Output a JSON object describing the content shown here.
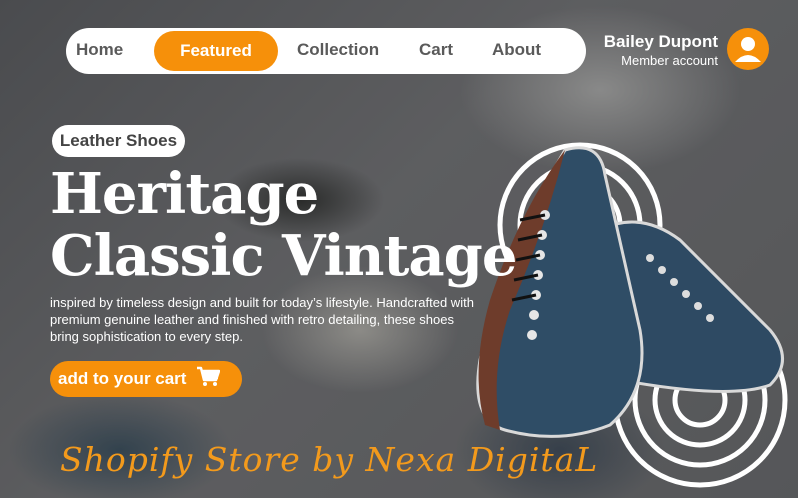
{
  "nav": {
    "items": [
      {
        "label": "Home"
      },
      {
        "label": "Featured"
      },
      {
        "label": "Collection"
      },
      {
        "label": "Cart"
      },
      {
        "label": "About"
      }
    ],
    "active_index": 1
  },
  "user": {
    "name": "Bailey Dupont",
    "role": "Member account",
    "avatar_icon": "user-avatar-icon"
  },
  "hero": {
    "tag": "Leather Shoes",
    "title_line1": "Heritage",
    "title_line2": "Classic Vintage",
    "description": "inspired by timeless design and built for today’s lifestyle. Handcrafted with premium genuine leather and finished with retro detailing, these shoes bring sophistication to every step.",
    "cta_label": "add to your cart",
    "cta_icon": "shopping-cart-icon"
  },
  "footer": {
    "credit": "Shopify Store by Nexa DigitaL"
  },
  "colors": {
    "accent": "#f6900a",
    "text_light": "#ffffff",
    "nav_text": "#5a5a5a"
  }
}
